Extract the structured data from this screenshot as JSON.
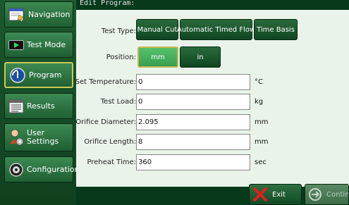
{
  "sidebar": {
    "items": [
      {
        "label": "Navigation",
        "icon": "navigation-icon"
      },
      {
        "label": "Test Mode",
        "icon": "play-tape-icon"
      },
      {
        "label": "Program",
        "icon": "program-globe-icon"
      },
      {
        "label": "Results",
        "icon": "results-list-icon"
      },
      {
        "label1": "User",
        "label2": "Settings",
        "icon": "user-settings-icon"
      },
      {
        "label": "Configuration",
        "icon": "gear-icon"
      }
    ],
    "active": "Program"
  },
  "header": {
    "title": "Edit Program:"
  },
  "test_type": {
    "label": "Test Type:",
    "options": [
      "Manual Cut",
      "Automatic Timed Flow",
      "Time Basis"
    ]
  },
  "position": {
    "label": "Position:",
    "options": [
      "mm",
      "in"
    ],
    "selected": "mm"
  },
  "fields": [
    {
      "label": "Set Temperature:",
      "value": "0",
      "unit": "°C"
    },
    {
      "label": "Test Load:",
      "value": "0",
      "unit": "kg"
    },
    {
      "label": "Orifice Diameter:",
      "value": "2.095",
      "unit": "mm"
    },
    {
      "label": "Orifice Length:",
      "value": "8",
      "unit": "mm"
    },
    {
      "label": "Preheat Time:",
      "value": "360",
      "unit": "sec"
    }
  ],
  "actions": {
    "exit": "Exit",
    "continue": "Continue"
  },
  "colors": {
    "selected": "#4fb865",
    "frame": "#063a1a",
    "panel": "#eaf3ea"
  }
}
